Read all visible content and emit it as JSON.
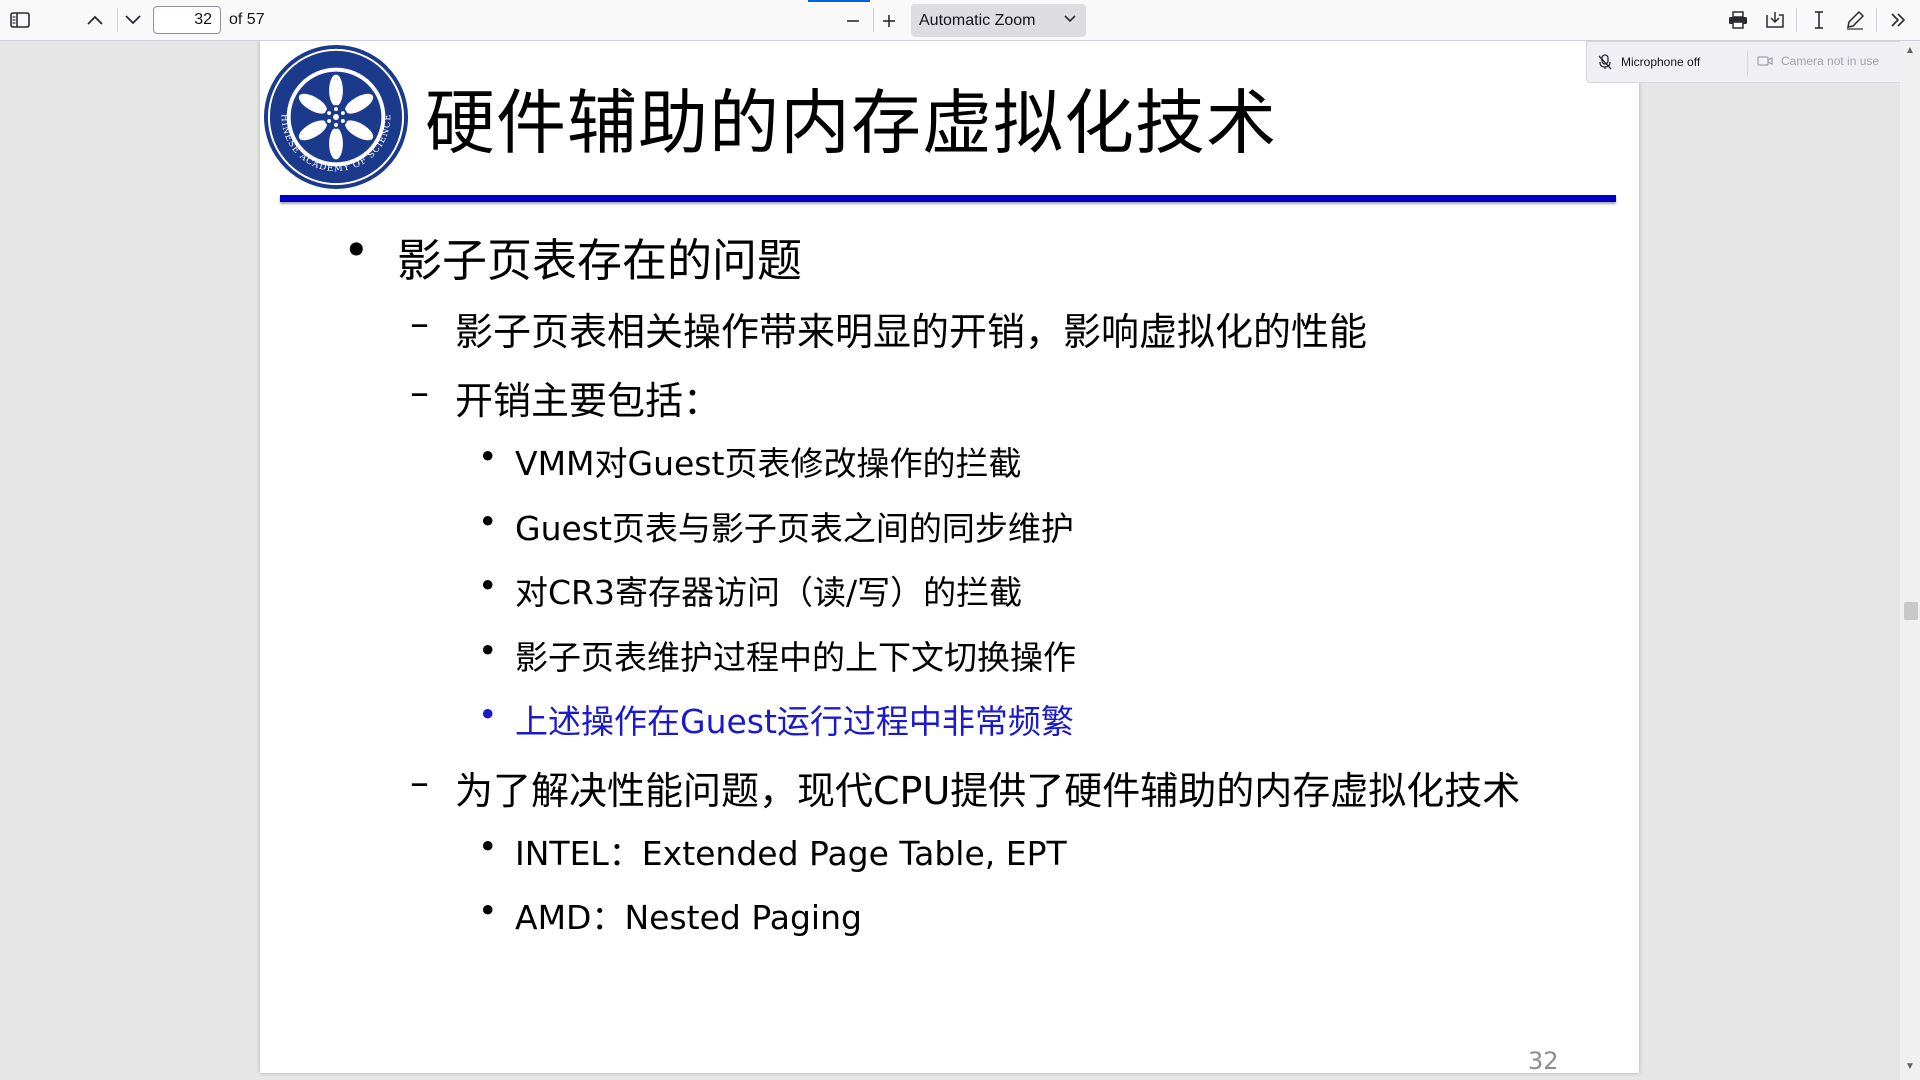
{
  "toolbar": {
    "page_number": "32",
    "page_count": "of 57",
    "zoom_label": "Automatic Zoom"
  },
  "media": {
    "microphone": "Microphone off",
    "camera": "Camera not in use"
  },
  "slide": {
    "title": "硬件辅助的内存虚拟化技术",
    "logo_text": "CHINESE ACADEMY OF SCIENCES",
    "bullets": [
      {
        "level": 1,
        "mark": "•",
        "text": "影子页表存在的问题"
      },
      {
        "level": 2,
        "mark": "–",
        "text": "影子页表相关操作带来明显的开销，影响虚拟化的性能"
      },
      {
        "level": 2,
        "mark": "–",
        "text": "开销主要包括："
      },
      {
        "level": 3,
        "mark": "•",
        "text": "VMM对Guest页表修改操作的拦截"
      },
      {
        "level": 3,
        "mark": "•",
        "text": "Guest页表与影子页表之间的同步维护"
      },
      {
        "level": 3,
        "mark": "•",
        "text": "对CR3寄存器访问（读/写）的拦截"
      },
      {
        "level": 3,
        "mark": "•",
        "text": "影子页表维护过程中的上下文切换操作"
      },
      {
        "level": 3,
        "mark": "•",
        "text": "上述操作在Guest运行过程中非常频繁",
        "color": "#1a1acc"
      },
      {
        "level": 2,
        "mark": "–",
        "text": "为了解决性能问题，现代CPU提供了硬件辅助的内存虚拟化技术"
      },
      {
        "level": 3,
        "mark": "•",
        "text": "INTEL：Extended Page Table, EPT"
      },
      {
        "level": 3,
        "mark": "•",
        "text": "AMD：Nested Paging"
      }
    ],
    "slide_number": "32"
  },
  "colors": {
    "title_rule": "#0000c8",
    "highlight_text": "#1a1acc",
    "logo_blue": "#1b3a8c"
  }
}
